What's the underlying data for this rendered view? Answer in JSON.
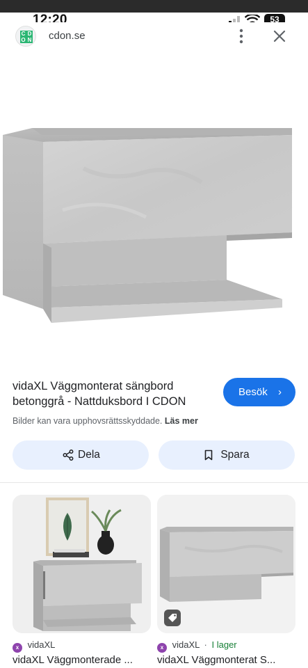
{
  "status_bar": {
    "time": "12:20",
    "battery": "53"
  },
  "url_bar": {
    "favicon_letters": [
      "C",
      "D",
      "O",
      "N"
    ],
    "domain": "cdon.se",
    "menu_icon": "more-vert-icon",
    "close_icon": "close-icon"
  },
  "result": {
    "title": "vidaXL Väggmonterat sängbord betonggrå - Nattduksbord I CDON",
    "visit_label": "Besök",
    "copyright_text": "Bilder kan vara upphovsrättsskyddade.",
    "learn_more": "Läs mer",
    "share_label": "Dela",
    "save_label": "Spara"
  },
  "related": [
    {
      "source": "vidaXL",
      "stock": "",
      "title": "vidaXL Väggmonterade ..."
    },
    {
      "source": "vidaXL",
      "stock": "I lager",
      "title": "vidaXL Väggmonterat S..."
    }
  ],
  "colors": {
    "accent": "#1a73e8",
    "pill_bg": "#e8f0fe",
    "in_stock": "#188038",
    "concrete": "#c9c9c9"
  }
}
